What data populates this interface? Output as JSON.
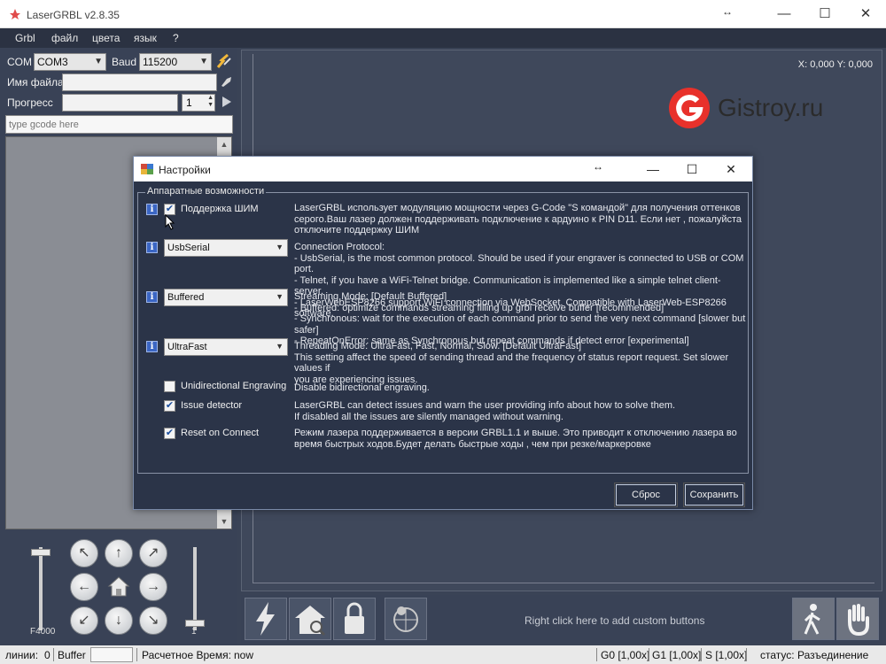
{
  "window": {
    "title": "LaserGRBL v2.8.35",
    "resize_glyph": "↔",
    "min": "—",
    "max": "☐",
    "close": "✕"
  },
  "menu": [
    "Grbl",
    "файл",
    "цвета",
    "язык",
    "?"
  ],
  "connection": {
    "com_label": "COM",
    "com_value": "COM3",
    "baud_label": "Baud",
    "baud_value": "115200"
  },
  "file": {
    "label": "Имя файла",
    "value": ""
  },
  "progress": {
    "label": "Прогресс",
    "count": "1"
  },
  "gcode_input": {
    "placeholder": "type gcode here"
  },
  "jog": {
    "feed_label": "F4000",
    "step_label": "1"
  },
  "coords": "X: 0,000 Y: 0,000",
  "custom_hint": "Right click here to add custom buttons",
  "logo_text": "Gistroy.ru",
  "status": {
    "lines_label": "линии:",
    "lines_value": "0",
    "buffer_label": "Buffer",
    "time_label": "Расчетное Время:",
    "time_value": "now",
    "g0": "G0 [1,00x]",
    "g1": "G1 [1,00x]",
    "s": "S [1,00x]",
    "state_label": "статус:",
    "state_value": "Разъединение"
  },
  "dialog": {
    "title": "Настройки",
    "group_title": "Аппаратные возможности",
    "options": [
      {
        "label": "Поддержка ШИМ",
        "checked": true,
        "desc": "LaserGRBL использует модуляцию мощности через G-Code \"S командой\" для получения оттенков\nсерого.Ваш лазер должен поддерживать подключение к ардуино к PIN D11. Если нет , пожалуйста\nотключите поддержку ШИМ"
      },
      {
        "combo": "UsbSerial",
        "desc": "Connection Protocol:\n- UsbSerial, is the most common protocol. Should be used if your engraver is connected to USB or COM port.\n- Telnet, if you have a WiFi-Telnet bridge. Communication is implemented like a simple telnet client-server.\n- LaserWebESP8266 support WiFi connection via WebSocket. Compatible with LaserWeb-ESP8266 software."
      },
      {
        "combo": "Buffered",
        "desc": "Streaming Mode: [Default Buffered]\n- Buffered: optimize commands streaming filling up grbl receive buffer [recommended]\n- Synchronous: wait for the execution of each command prior to send the very next command [slower but safer]\n- RepeatOnError:  same as Synchronous but repeat commands if detect error [experimental]"
      },
      {
        "combo": "UltraFast",
        "desc": "Threading Mode: UltraFast, Fast, Normal, Slow. [Default UltraFast]\nThis setting affect the speed of sending thread and the frequency of status report request. Set slower values if\nyou are experiencing issues."
      },
      {
        "label": "Unidirectional Engraving",
        "checked": false,
        "desc": "Disable bidirectional engraving."
      },
      {
        "label": "Issue detector",
        "checked": true,
        "desc": "LaserGRBL can detect issues and warn the user providing info about how to solve them.\nIf disabled all the issues are silently managed without warning."
      },
      {
        "label": "Reset on Connect",
        "checked": true,
        "desc": "Режим лазера поддерживается  в версии GRBL1.1 и выше. Это приводит к отключению лазера во\nвремя быстрых ходов.Будет делать быстрые ходы , чем при резке/маркеровке"
      }
    ],
    "reset_label": "Сброс",
    "save_label": "Сохранить"
  },
  "colors": {
    "panel": "#394256",
    "dialog": "#2b3448",
    "logo_red": "#e8312b"
  }
}
